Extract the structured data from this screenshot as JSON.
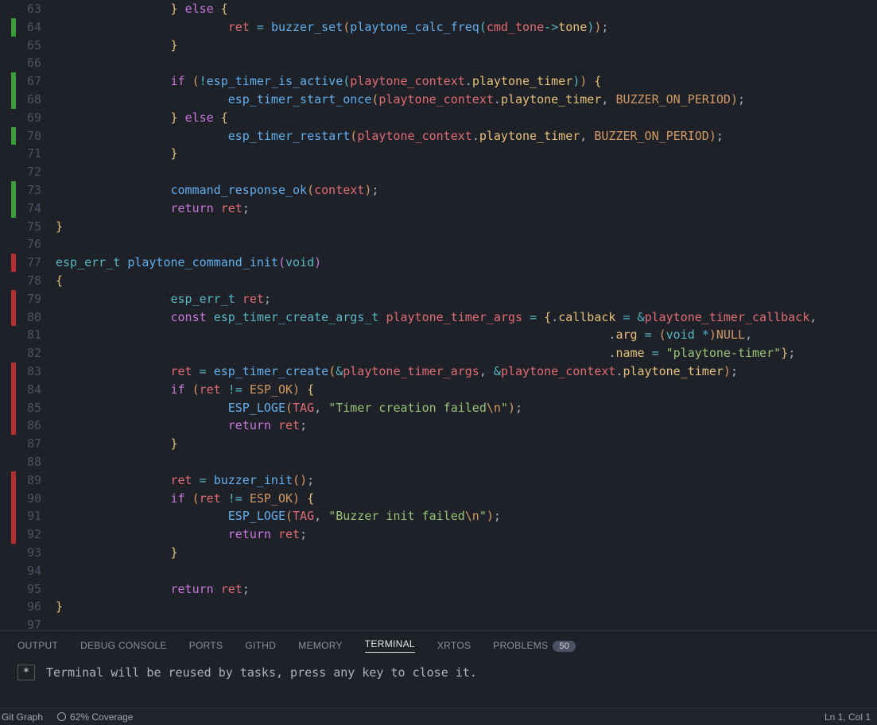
{
  "lines": [
    {
      "n": 63,
      "mark": "none",
      "tokens": [
        [
          "guide",
          "        "
        ],
        [
          "guide",
          "        "
        ],
        [
          "brace",
          "}"
        ],
        [
          "default",
          " "
        ],
        [
          "keyword",
          "else"
        ],
        [
          "default",
          " "
        ],
        [
          "brace",
          "{"
        ]
      ]
    },
    {
      "n": 64,
      "mark": "green",
      "tokens": [
        [
          "guide",
          "        "
        ],
        [
          "guide",
          "        "
        ],
        [
          "default",
          "        "
        ],
        [
          "ident",
          "ret"
        ],
        [
          "default",
          " "
        ],
        [
          "op",
          "="
        ],
        [
          "default",
          " "
        ],
        [
          "func",
          "buzzer_set"
        ],
        [
          "paren",
          "("
        ],
        [
          "func",
          "playtone_calc_freq"
        ],
        [
          "brace3",
          "("
        ],
        [
          "ident",
          "cmd_tone"
        ],
        [
          "op",
          "->"
        ],
        [
          "prop",
          "tone"
        ],
        [
          "brace3",
          ")"
        ],
        [
          "paren",
          ")"
        ],
        [
          "punc",
          ";"
        ]
      ]
    },
    {
      "n": 65,
      "mark": "none",
      "tokens": [
        [
          "guide",
          "        "
        ],
        [
          "guide",
          "        "
        ],
        [
          "brace",
          "}"
        ]
      ]
    },
    {
      "n": 66,
      "mark": "none",
      "tokens": [
        [
          "default",
          ""
        ]
      ]
    },
    {
      "n": 67,
      "mark": "green",
      "tokens": [
        [
          "guide",
          "        "
        ],
        [
          "guide",
          "        "
        ],
        [
          "keyword",
          "if"
        ],
        [
          "default",
          " "
        ],
        [
          "paren",
          "("
        ],
        [
          "op",
          "!"
        ],
        [
          "func",
          "esp_timer_is_active"
        ],
        [
          "brace3",
          "("
        ],
        [
          "ident",
          "playtone_context"
        ],
        [
          "punc",
          "."
        ],
        [
          "prop",
          "playtone_timer"
        ],
        [
          "brace3",
          ")"
        ],
        [
          "paren",
          ")"
        ],
        [
          "default",
          " "
        ],
        [
          "brace",
          "{"
        ]
      ]
    },
    {
      "n": 68,
      "mark": "green",
      "tokens": [
        [
          "guide",
          "        "
        ],
        [
          "guide",
          "        "
        ],
        [
          "default",
          "        "
        ],
        [
          "func",
          "esp_timer_start_once"
        ],
        [
          "paren",
          "("
        ],
        [
          "ident",
          "playtone_context"
        ],
        [
          "punc",
          "."
        ],
        [
          "prop",
          "playtone_timer"
        ],
        [
          "punc",
          ", "
        ],
        [
          "const",
          "BUZZER_ON_PERIOD"
        ],
        [
          "paren",
          ")"
        ],
        [
          "punc",
          ";"
        ]
      ]
    },
    {
      "n": 69,
      "mark": "none",
      "tokens": [
        [
          "guide",
          "        "
        ],
        [
          "guide",
          "        "
        ],
        [
          "brace",
          "}"
        ],
        [
          "default",
          " "
        ],
        [
          "keyword",
          "else"
        ],
        [
          "default",
          " "
        ],
        [
          "brace",
          "{"
        ]
      ]
    },
    {
      "n": 70,
      "mark": "green",
      "tokens": [
        [
          "guide",
          "        "
        ],
        [
          "guide",
          "        "
        ],
        [
          "default",
          "        "
        ],
        [
          "func",
          "esp_timer_restart"
        ],
        [
          "paren",
          "("
        ],
        [
          "ident",
          "playtone_context"
        ],
        [
          "punc",
          "."
        ],
        [
          "prop",
          "playtone_timer"
        ],
        [
          "punc",
          ", "
        ],
        [
          "const",
          "BUZZER_ON_PERIOD"
        ],
        [
          "paren",
          ")"
        ],
        [
          "punc",
          ";"
        ]
      ]
    },
    {
      "n": 71,
      "mark": "none",
      "tokens": [
        [
          "guide",
          "        "
        ],
        [
          "guide",
          "        "
        ],
        [
          "brace",
          "}"
        ]
      ]
    },
    {
      "n": 72,
      "mark": "none",
      "tokens": [
        [
          "default",
          ""
        ]
      ]
    },
    {
      "n": 73,
      "mark": "green",
      "tokens": [
        [
          "guide",
          "        "
        ],
        [
          "guide",
          "        "
        ],
        [
          "func",
          "command_response_ok"
        ],
        [
          "paren",
          "("
        ],
        [
          "ident",
          "context"
        ],
        [
          "paren",
          ")"
        ],
        [
          "punc",
          ";"
        ]
      ]
    },
    {
      "n": 74,
      "mark": "green",
      "tokens": [
        [
          "guide",
          "        "
        ],
        [
          "guide",
          "        "
        ],
        [
          "keyword",
          "return"
        ],
        [
          "default",
          " "
        ],
        [
          "ident",
          "ret"
        ],
        [
          "punc",
          ";"
        ]
      ]
    },
    {
      "n": 75,
      "mark": "none",
      "tokens": [
        [
          "brace",
          "}"
        ]
      ]
    },
    {
      "n": 76,
      "mark": "none",
      "tokens": [
        [
          "default",
          ""
        ]
      ]
    },
    {
      "n": 77,
      "mark": "red",
      "tokens": [
        [
          "type",
          "esp_err_t"
        ],
        [
          "default",
          " "
        ],
        [
          "func",
          "playtone_command_init"
        ],
        [
          "brace2",
          "("
        ],
        [
          "type",
          "void"
        ],
        [
          "brace2",
          ")"
        ]
      ]
    },
    {
      "n": 78,
      "mark": "none",
      "tokens": [
        [
          "brace",
          "{"
        ]
      ]
    },
    {
      "n": 79,
      "mark": "red",
      "tokens": [
        [
          "guide",
          "        "
        ],
        [
          "guide",
          "        "
        ],
        [
          "type",
          "esp_err_t"
        ],
        [
          "default",
          " "
        ],
        [
          "ident",
          "ret"
        ],
        [
          "punc",
          ";"
        ]
      ]
    },
    {
      "n": 80,
      "mark": "red",
      "tokens": [
        [
          "guide",
          "        "
        ],
        [
          "guide",
          "        "
        ],
        [
          "keyword",
          "const"
        ],
        [
          "default",
          " "
        ],
        [
          "type",
          "esp_timer_create_args_t"
        ],
        [
          "default",
          " "
        ],
        [
          "ident",
          "playtone_timer_args"
        ],
        [
          "default",
          " "
        ],
        [
          "op",
          "="
        ],
        [
          "default",
          " "
        ],
        [
          "brace",
          "{"
        ],
        [
          "punc",
          "."
        ],
        [
          "prop",
          "callback"
        ],
        [
          "default",
          " "
        ],
        [
          "op",
          "="
        ],
        [
          "default",
          " "
        ],
        [
          "op",
          "&"
        ],
        [
          "ident",
          "playtone_timer_callback"
        ],
        [
          "punc",
          ","
        ]
      ]
    },
    {
      "n": 81,
      "mark": "none",
      "tokens": [
        [
          "guide",
          "        "
        ],
        [
          "guide",
          "        "
        ],
        [
          "guide",
          "        "
        ],
        [
          "guide",
          "        "
        ],
        [
          "guide",
          "        "
        ],
        [
          "guide",
          "        "
        ],
        [
          "guide",
          "        "
        ],
        [
          "guide",
          "        "
        ],
        [
          "default",
          "             "
        ],
        [
          "punc",
          "."
        ],
        [
          "prop",
          "arg"
        ],
        [
          "default",
          " "
        ],
        [
          "op",
          "="
        ],
        [
          "default",
          " "
        ],
        [
          "paren",
          "("
        ],
        [
          "type",
          "void"
        ],
        [
          "default",
          " "
        ],
        [
          "op",
          "*"
        ],
        [
          "paren",
          ")"
        ],
        [
          "const",
          "NULL"
        ],
        [
          "punc",
          ","
        ]
      ]
    },
    {
      "n": 82,
      "mark": "none",
      "tokens": [
        [
          "guide",
          "        "
        ],
        [
          "guide",
          "        "
        ],
        [
          "guide",
          "        "
        ],
        [
          "guide",
          "        "
        ],
        [
          "guide",
          "        "
        ],
        [
          "guide",
          "        "
        ],
        [
          "guide",
          "        "
        ],
        [
          "guide",
          "        "
        ],
        [
          "default",
          "             "
        ],
        [
          "punc",
          "."
        ],
        [
          "prop",
          "name"
        ],
        [
          "default",
          " "
        ],
        [
          "op",
          "="
        ],
        [
          "default",
          " "
        ],
        [
          "string",
          "\"playtone-timer\""
        ],
        [
          "brace",
          "}"
        ],
        [
          "punc",
          ";"
        ]
      ]
    },
    {
      "n": 83,
      "mark": "red",
      "tokens": [
        [
          "guide",
          "        "
        ],
        [
          "guide",
          "        "
        ],
        [
          "ident",
          "ret"
        ],
        [
          "default",
          " "
        ],
        [
          "op",
          "="
        ],
        [
          "default",
          " "
        ],
        [
          "func",
          "esp_timer_create"
        ],
        [
          "paren",
          "("
        ],
        [
          "op",
          "&"
        ],
        [
          "ident",
          "playtone_timer_args"
        ],
        [
          "punc",
          ", "
        ],
        [
          "op",
          "&"
        ],
        [
          "ident",
          "playtone_context"
        ],
        [
          "punc",
          "."
        ],
        [
          "prop",
          "playtone_timer"
        ],
        [
          "paren",
          ")"
        ],
        [
          "punc",
          ";"
        ]
      ]
    },
    {
      "n": 84,
      "mark": "red",
      "tokens": [
        [
          "guide",
          "        "
        ],
        [
          "guide",
          "        "
        ],
        [
          "keyword",
          "if"
        ],
        [
          "default",
          " "
        ],
        [
          "paren",
          "("
        ],
        [
          "ident",
          "ret"
        ],
        [
          "default",
          " "
        ],
        [
          "op",
          "!="
        ],
        [
          "default",
          " "
        ],
        [
          "const",
          "ESP_OK"
        ],
        [
          "paren",
          ")"
        ],
        [
          "default",
          " "
        ],
        [
          "brace",
          "{"
        ]
      ]
    },
    {
      "n": 85,
      "mark": "red",
      "tokens": [
        [
          "guide",
          "        "
        ],
        [
          "guide",
          "        "
        ],
        [
          "default",
          "        "
        ],
        [
          "func",
          "ESP_LOGE"
        ],
        [
          "paren",
          "("
        ],
        [
          "ident",
          "TAG"
        ],
        [
          "punc",
          ", "
        ],
        [
          "string",
          "\"Timer creation failed"
        ],
        [
          "const",
          "\\n"
        ],
        [
          "string",
          "\""
        ],
        [
          "paren",
          ")"
        ],
        [
          "punc",
          ";"
        ]
      ]
    },
    {
      "n": 86,
      "mark": "red",
      "tokens": [
        [
          "guide",
          "        "
        ],
        [
          "guide",
          "        "
        ],
        [
          "default",
          "        "
        ],
        [
          "keyword",
          "return"
        ],
        [
          "default",
          " "
        ],
        [
          "ident",
          "ret"
        ],
        [
          "punc",
          ";"
        ]
      ]
    },
    {
      "n": 87,
      "mark": "none",
      "tokens": [
        [
          "guide",
          "        "
        ],
        [
          "guide",
          "        "
        ],
        [
          "brace",
          "}"
        ]
      ]
    },
    {
      "n": 88,
      "mark": "none",
      "tokens": [
        [
          "default",
          ""
        ]
      ]
    },
    {
      "n": 89,
      "mark": "red",
      "tokens": [
        [
          "guide",
          "        "
        ],
        [
          "guide",
          "        "
        ],
        [
          "ident",
          "ret"
        ],
        [
          "default",
          " "
        ],
        [
          "op",
          "="
        ],
        [
          "default",
          " "
        ],
        [
          "func",
          "buzzer_init"
        ],
        [
          "paren",
          "("
        ],
        [
          "paren",
          ")"
        ],
        [
          "punc",
          ";"
        ]
      ]
    },
    {
      "n": 90,
      "mark": "red",
      "tokens": [
        [
          "guide",
          "        "
        ],
        [
          "guide",
          "        "
        ],
        [
          "keyword",
          "if"
        ],
        [
          "default",
          " "
        ],
        [
          "paren",
          "("
        ],
        [
          "ident",
          "ret"
        ],
        [
          "default",
          " "
        ],
        [
          "op",
          "!="
        ],
        [
          "default",
          " "
        ],
        [
          "const",
          "ESP_OK"
        ],
        [
          "paren",
          ")"
        ],
        [
          "default",
          " "
        ],
        [
          "brace",
          "{"
        ]
      ]
    },
    {
      "n": 91,
      "mark": "red",
      "tokens": [
        [
          "guide",
          "        "
        ],
        [
          "guide",
          "        "
        ],
        [
          "default",
          "        "
        ],
        [
          "func",
          "ESP_LOGE"
        ],
        [
          "paren",
          "("
        ],
        [
          "ident",
          "TAG"
        ],
        [
          "punc",
          ", "
        ],
        [
          "string",
          "\"Buzzer init failed"
        ],
        [
          "const",
          "\\n"
        ],
        [
          "string",
          "\""
        ],
        [
          "paren",
          ")"
        ],
        [
          "punc",
          ";"
        ]
      ]
    },
    {
      "n": 92,
      "mark": "red",
      "tokens": [
        [
          "guide",
          "        "
        ],
        [
          "guide",
          "        "
        ],
        [
          "default",
          "        "
        ],
        [
          "keyword",
          "return"
        ],
        [
          "default",
          " "
        ],
        [
          "ident",
          "ret"
        ],
        [
          "punc",
          ";"
        ]
      ]
    },
    {
      "n": 93,
      "mark": "none",
      "tokens": [
        [
          "guide",
          "        "
        ],
        [
          "guide",
          "        "
        ],
        [
          "brace",
          "}"
        ]
      ]
    },
    {
      "n": 94,
      "mark": "none",
      "tokens": [
        [
          "default",
          ""
        ]
      ]
    },
    {
      "n": 95,
      "mark": "none",
      "tokens": [
        [
          "guide",
          "        "
        ],
        [
          "guide",
          "        "
        ],
        [
          "keyword",
          "return"
        ],
        [
          "default",
          " "
        ],
        [
          "ident",
          "ret"
        ],
        [
          "punc",
          ";"
        ]
      ]
    },
    {
      "n": 96,
      "mark": "none",
      "tokens": [
        [
          "brace",
          "}"
        ]
      ]
    },
    {
      "n": 97,
      "mark": "none",
      "tokens": [
        [
          "default",
          ""
        ]
      ]
    }
  ],
  "panel": {
    "tabs": [
      "OUTPUT",
      "DEBUG CONSOLE",
      "PORTS",
      "GITHD",
      "MEMORY",
      "TERMINAL",
      "XRTOS",
      "PROBLEMS"
    ],
    "active_tab": "TERMINAL",
    "problems_badge": "50",
    "terminal_marker": "*",
    "terminal_text": "Terminal will be reused by tasks, press any key to close it."
  },
  "statusbar": {
    "git_graph": "Git Graph",
    "coverage": "62% Coverage",
    "position": "Ln 1, Col 1"
  }
}
